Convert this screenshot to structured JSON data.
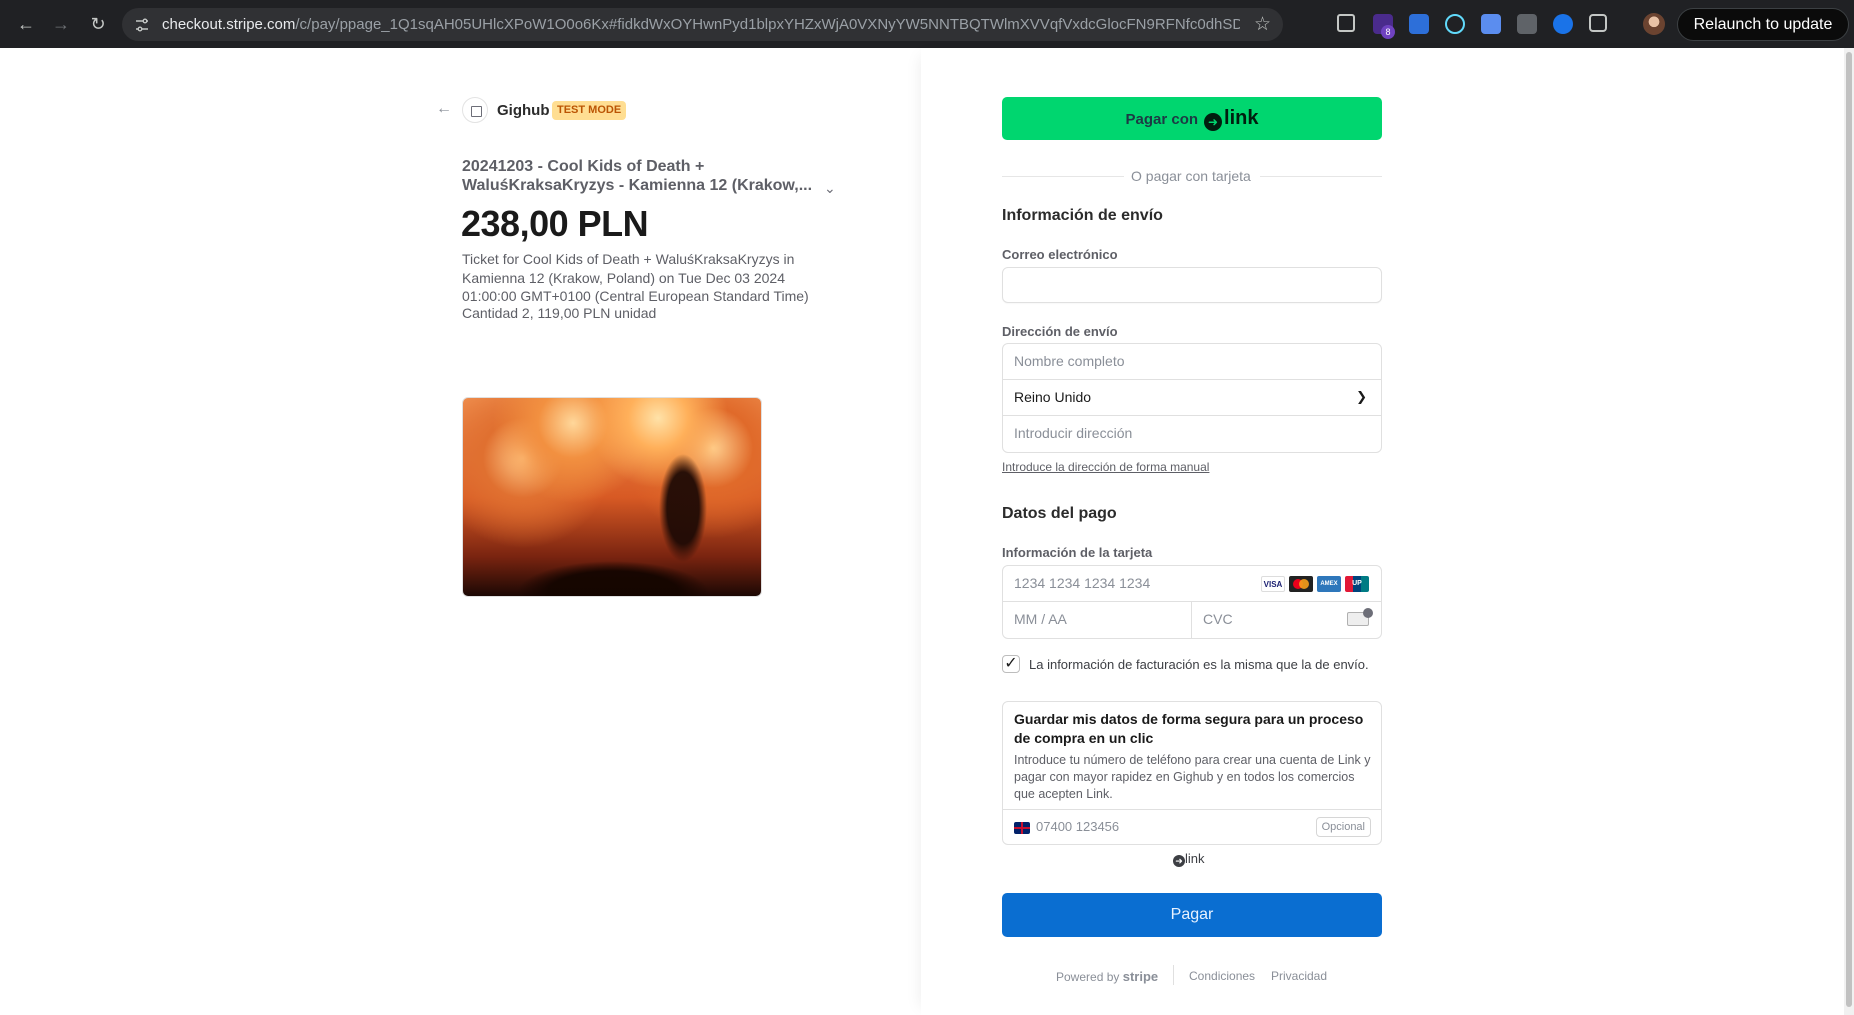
{
  "browser": {
    "url_host": "checkout.stripe.com",
    "url_path": "/c/pay/ppage_1Q1sqAH05UHlcXPoW1O0o6Kx#fidkdWxOYHwnPyd1blpxYHZxWjA0VXNyYW5NNTBQTWlmXVVqfVxdcGlocFN9RFNfc0dhSDVKVmJkYV91d...",
    "extension_badge": "8",
    "relaunch_label": "Relaunch to update"
  },
  "merchant": {
    "name": "Gighub",
    "test_mode_label": "TEST MODE"
  },
  "product": {
    "name": "20241203 - Cool Kids of Death + WaluśKraksaKryzys - Kamienna 12 (Krakow,...",
    "price": "238,00 PLN",
    "description": "Ticket for Cool Kids of Death + WaluśKraksaKryzys in Kamienna 12 (Krakow, Poland) on Tue Dec 03 2024 01:00:00 GMT+0100 (Central European Standard Time)",
    "quantity": "Cantidad 2, 119,00 PLN unidad"
  },
  "checkout": {
    "link_button_prefix": "Pagar con",
    "link_logo": "link",
    "or_divider": "O pagar con tarjeta",
    "shipping_title": "Información de envío",
    "email_label": "Correo electrónico",
    "email_value": "",
    "shipping_address_label": "Dirección de envío",
    "full_name_placeholder": "Nombre completo",
    "country_value": "Reino Unido",
    "address_placeholder": "Introducir dirección",
    "manual_address_link": "Introduce la dirección de forma manual",
    "payment_title": "Datos del pago",
    "card_info_label": "Información de la tarjeta",
    "card_number_placeholder": "1234 1234 1234 1234",
    "expiry_placeholder": "MM / AA",
    "cvc_placeholder": "CVC",
    "card_brands": [
      "VISA",
      "MC",
      "AMEX",
      "UP"
    ],
    "billing_same_label": "La información de facturación es la misma que la de envío.",
    "billing_same_checked": true,
    "link_save_title": "Guardar mis datos de forma segura para un proceso de compra en un clic",
    "link_save_body": "Introduce tu número de teléfono para crear una cuenta de Link y pagar con mayor rapidez en Gighub y en todos los comercios que acepten Link.",
    "phone_placeholder": "07400 123456",
    "optional_label": "Opcional",
    "link_footer_logo": "link",
    "pay_button": "Pagar"
  },
  "footer": {
    "powered_by": "Powered by",
    "stripe": "stripe",
    "terms": "Condiciones",
    "privacy": "Privacidad"
  },
  "colors": {
    "link_green": "#00d66f",
    "pay_blue": "#0a6ed1",
    "test_mode_bg": "#ffde92",
    "test_mode_text": "#bb5504"
  }
}
